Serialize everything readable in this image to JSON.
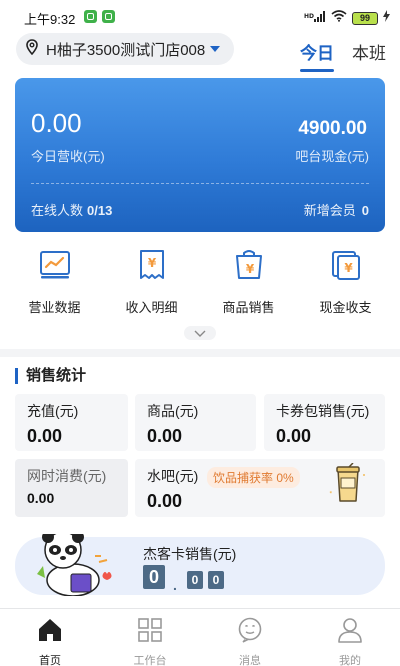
{
  "status_bar": {
    "time": "上午9:32",
    "battery": "99"
  },
  "store": {
    "name": "H柚子3500测试门店008"
  },
  "period_tabs": {
    "today": "今日",
    "shift": "本班"
  },
  "revenue_card": {
    "today_revenue_value": "0.00",
    "today_revenue_label": "今日营收(元)",
    "bar_cash_value": "4900.00",
    "bar_cash_label": "吧台现金(元)",
    "online_label": "在线人数",
    "online_value": "0/13",
    "new_member_label": "新增会员",
    "new_member_value": "0"
  },
  "quick_actions": [
    {
      "label": "营业数据",
      "icon": "business-chart-icon"
    },
    {
      "label": "收入明细",
      "icon": "income-receipt-icon"
    },
    {
      "label": "商品销售",
      "icon": "shopping-bag-icon"
    },
    {
      "label": "现金收支",
      "icon": "cash-flow-icon"
    }
  ],
  "sales_stats": {
    "title": "销售统计",
    "recharge": {
      "label": "充值(元)",
      "value": "0.00"
    },
    "goods": {
      "label": "商品(元)",
      "value": "0.00"
    },
    "coupon_pack": {
      "label": "卡券包销售(元)",
      "value": "0.00"
    },
    "net_time": {
      "label": "网时消费(元)",
      "value": "0.00"
    },
    "water_bar": {
      "label": "水吧(元)",
      "value": "0.00",
      "badge": "饮品捕获率 0%"
    },
    "jieke_card": {
      "label": "杰客卡销售(元)",
      "digit_main": "0",
      "dot": ".",
      "digit_small_1": "0",
      "digit_small_2": "0"
    }
  },
  "tab_bar": [
    {
      "label": "首页",
      "icon": "home-icon",
      "active": true
    },
    {
      "label": "工作台",
      "icon": "workbench-icon",
      "active": false
    },
    {
      "label": "消息",
      "icon": "message-icon",
      "active": false
    },
    {
      "label": "我的",
      "icon": "profile-icon",
      "active": false
    }
  ],
  "colors": {
    "accent": "#1e63c4",
    "card_gradient_top": "#4a98ea",
    "card_gradient_bottom": "#1d63bf",
    "badge_orange": "#e07a30"
  }
}
